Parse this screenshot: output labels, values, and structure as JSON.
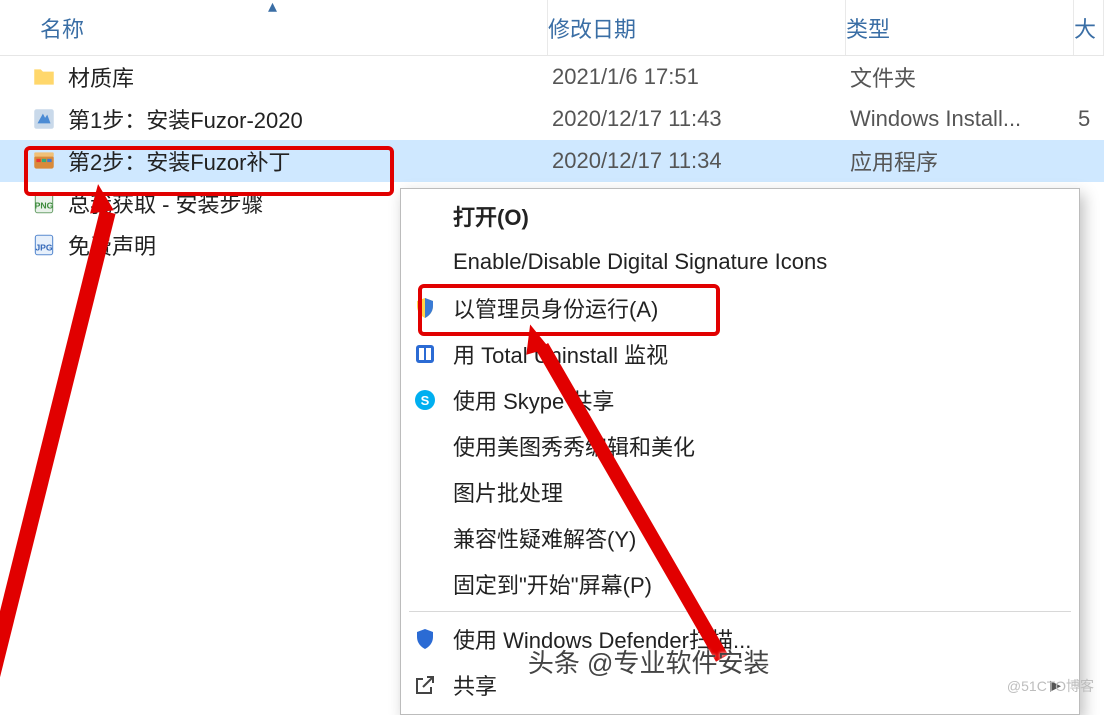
{
  "columns": {
    "name": "名称",
    "date": "修改日期",
    "type": "类型",
    "size": "大"
  },
  "files": [
    {
      "icon": "folder",
      "name": "材质库",
      "date": "2021/1/6 17:51",
      "type": "文件夹",
      "size": ""
    },
    {
      "icon": "msi",
      "name": "第1步：安装Fuzor-2020",
      "date": "2020/12/17 11:43",
      "type": "Windows Install...",
      "size": "5"
    },
    {
      "icon": "app",
      "name": "第2步：安装Fuzor补丁",
      "date": "2020/12/17 11:34",
      "type": "应用程序",
      "size": ""
    },
    {
      "icon": "png",
      "name": "总我获取 - 安装步骤",
      "date": "",
      "type": "",
      "size": ""
    },
    {
      "icon": "jpg",
      "name": "免费声明",
      "date": "",
      "type": "",
      "size": ""
    }
  ],
  "selected_index": 2,
  "context_menu": {
    "items": [
      {
        "label": "打开(O)",
        "bold": true
      },
      {
        "label": "Enable/Disable Digital Signature Icons"
      },
      {
        "label": "以管理员身份运行(A)",
        "icon": "shield"
      },
      {
        "label": "用 Total Uninstall 监视",
        "icon": "tu"
      },
      {
        "label": "使用 Skype 共享",
        "icon": "skype"
      },
      {
        "label": "使用美图秀秀编辑和美化"
      },
      {
        "label": "图片批处理"
      },
      {
        "label": "兼容性疑难解答(Y)"
      },
      {
        "label": "固定到\"开始\"屏幕(P)"
      },
      {
        "label": "使用 Windows Defender扫描...",
        "icon": "defender"
      },
      {
        "label": "共享",
        "icon": "share",
        "expand": true
      }
    ]
  },
  "watermarks": {
    "center": "头条 @专业软件安装",
    "right": "@51CTO博客"
  }
}
